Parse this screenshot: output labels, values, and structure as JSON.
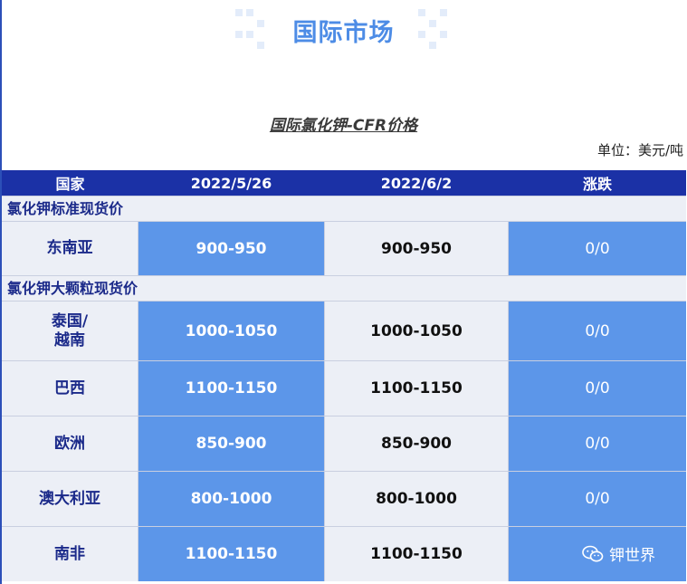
{
  "banner": {
    "title": "国际市场"
  },
  "subtitle": "国际氯化钾-CFR价格",
  "unit": "单位：美元/吨",
  "table": {
    "headers": [
      "国家",
      "2022/5/26",
      "2022/6/2",
      "涨跌"
    ],
    "sections": [
      {
        "label": "氯化钾标准现货价",
        "rows": [
          {
            "country": "东南亚",
            "price_0526": "900-950",
            "price_0602": "900-950",
            "change": "0/0"
          }
        ]
      },
      {
        "label": "氯化钾大颗粒现货价",
        "rows": [
          {
            "country": "泰国/\n越南",
            "price_0526": "1000-1050",
            "price_0602": "1000-1050",
            "change": "0/0"
          },
          {
            "country": "巴西",
            "price_0526": "1100-1150",
            "price_0602": "1100-1150",
            "change": "0/0"
          },
          {
            "country": "欧洲",
            "price_0526": "850-900",
            "price_0602": "850-900",
            "change": "0/0"
          },
          {
            "country": "澳大利亚",
            "price_0526": "800-1000",
            "price_0602": "800-1000",
            "change": "0/0"
          },
          {
            "country": "南非",
            "price_0526": "1100-1150",
            "price_0602": "1100-1150",
            "change": ""
          }
        ]
      }
    ]
  },
  "watermark": {
    "text": "钾世界",
    "icon": "wechat-icon"
  },
  "colors": {
    "header_bg": "#1b31a6",
    "accent_blue": "#5c96e9",
    "light_row": "#eceff6",
    "title_blue": "#4d8ce6",
    "label_navy": "#1b2a8a"
  }
}
